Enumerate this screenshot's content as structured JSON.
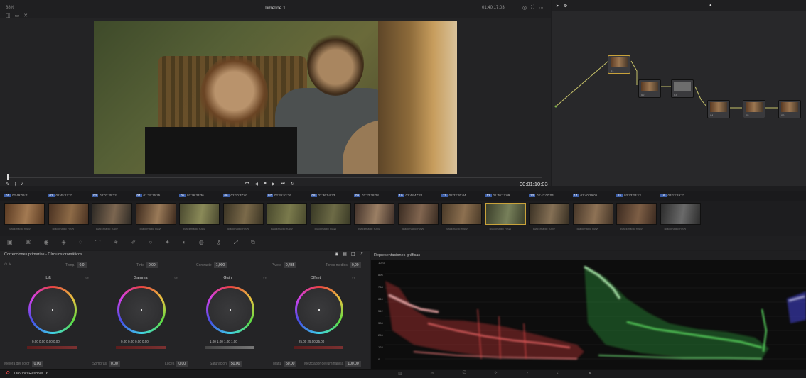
{
  "viewer": {
    "zoom": "88%",
    "timeline_name": "Timeline 1",
    "top_timecode": "01:40:17:03",
    "timecode": "00:01:10:03",
    "transport": [
      "⏮",
      "◀",
      "■",
      "▶",
      "⏭",
      "↻"
    ]
  },
  "clips": [
    {
      "num": "01",
      "tc": "02:49:09:01",
      "label": "Blackmagic RAW"
    },
    {
      "num": "02",
      "tc": "02:45:17:33",
      "label": "Blackmagic RAW"
    },
    {
      "num": "03",
      "tc": "03:07:25:22",
      "label": "Blackmagic RAW"
    },
    {
      "num": "04",
      "tc": "01:39:16:25",
      "label": "Blackmagic RAW"
    },
    {
      "num": "05",
      "tc": "02:36:33:36",
      "label": "Blackmagic RAW"
    },
    {
      "num": "06",
      "tc": "02:10:37:07",
      "label": "Blackmagic RAW"
    },
    {
      "num": "07",
      "tc": "02:36:53:36",
      "label": "Blackmagic RAW"
    },
    {
      "num": "08",
      "tc": "02:36:54:33",
      "label": "Blackmagic RAW"
    },
    {
      "num": "09",
      "tc": "02:22:28:28",
      "label": "Blackmagic RAW"
    },
    {
      "num": "10",
      "tc": "02:48:47:22",
      "label": "Blackmagic RAW"
    },
    {
      "num": "11",
      "tc": "02:22:30:04",
      "label": "Blackmagic RAW"
    },
    {
      "num": "12",
      "tc": "01:40:17:09",
      "label": "Blackmagic RAW"
    },
    {
      "num": "13",
      "tc": "02:47:00:04",
      "label": "Blackmagic RAW"
    },
    {
      "num": "14",
      "tc": "01:40:29:06",
      "label": "Blackmagic RAW"
    },
    {
      "num": "15",
      "tc": "03:23:23:13",
      "label": "Blackmagic RAW"
    },
    {
      "num": "16",
      "tc": "03:13:19:27",
      "label": "Blackmagic RAW"
    }
  ],
  "wheels": {
    "title": "Correcciones primarias - Círculos cromáticos",
    "params": {
      "temp_label": "Temp.",
      "temp_value": "0,0",
      "tint_label": "Tinte",
      "tint_value": "0,00",
      "contrast_label": "Contraste",
      "contrast_value": "1,000",
      "pivot_label": "Pivote",
      "pivot_value": "0,435",
      "middetail_label": "Tonos medios",
      "middetail_value": "0,00",
      "colorboost_label": "Mejora del color",
      "colorboost_value": "0,00",
      "shadows_label": "Sombras",
      "shadows_value": "0,00",
      "highlights_label": "Luces",
      "highlights_value": "0,00",
      "saturation_label": "Saturación",
      "saturation_value": "50,00",
      "hue_label": "Matiz",
      "hue_value": "50,00",
      "lummix_label": "Mezclador de luminancia",
      "lummix_value": "100,00"
    },
    "items": [
      {
        "name": "Lift",
        "values": "0,00   0,00   0,00   0,00"
      },
      {
        "name": "Gamma",
        "values": "0,00   0,00   0,00   0,00"
      },
      {
        "name": "Gain",
        "values": "1,00   1,00   1,00   1,00"
      },
      {
        "name": "Offset",
        "values": "25,00   25,00   25,00"
      }
    ]
  },
  "scopes": {
    "title": "Representaciones gráficas",
    "scale": [
      "1023",
      "896",
      "768",
      "640",
      "512",
      "384",
      "256",
      "128",
      "0"
    ]
  },
  "app": {
    "name": "DaVinci Resolve 16"
  },
  "colors": {
    "accent": "#3d5fa8",
    "parade_red": "#ff5a5a",
    "parade_green": "#5aff6a",
    "parade_blue": "#6a6aff"
  }
}
